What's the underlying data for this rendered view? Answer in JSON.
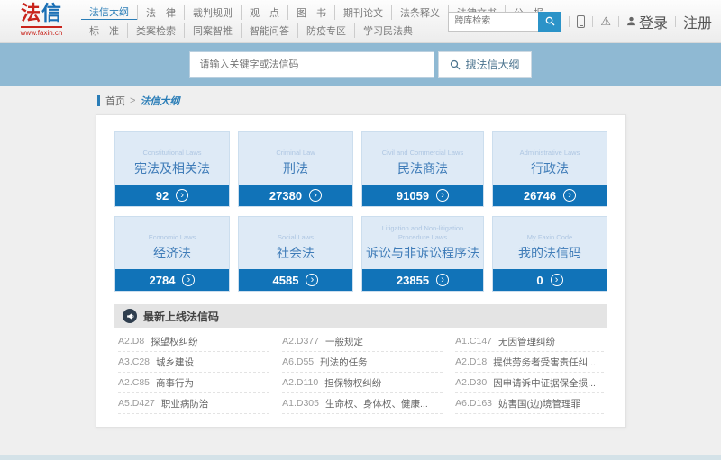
{
  "header": {
    "logo": {
      "text_red": "法",
      "text_blue": "信",
      "site_url": "www.faxin.cn"
    },
    "nav_row1": [
      {
        "label": "法信大纲"
      },
      {
        "label": "法　律"
      },
      {
        "label": "裁判规则"
      },
      {
        "label": "观　点"
      },
      {
        "label": "图　书"
      },
      {
        "label": "期刊论文"
      },
      {
        "label": "法条释义"
      },
      {
        "label": "法律文书"
      },
      {
        "label": "公　报"
      }
    ],
    "nav_row2": [
      {
        "label": "标　准"
      },
      {
        "label": "类案检索"
      },
      {
        "label": "同案智推"
      },
      {
        "label": "智能问答"
      },
      {
        "label": "防疫专区"
      },
      {
        "label": "学习民法典"
      }
    ],
    "mini_search": {
      "placeholder": "跨库检索"
    },
    "auth": {
      "login": "登录",
      "register": "注册"
    }
  },
  "search_bar": {
    "placeholder": "请输入关键字或法信码",
    "button": "搜法信大纲"
  },
  "breadcrumb": {
    "home": "首页",
    "separator": ">",
    "current": "法信大纲"
  },
  "cards": [
    {
      "en": "Constitutional Laws",
      "zh": "宪法及相关法",
      "count": "92"
    },
    {
      "en": "Criminal Law",
      "zh": "刑法",
      "count": "27380"
    },
    {
      "en": "Civil and Commercial Laws",
      "zh": "民法商法",
      "count": "91059"
    },
    {
      "en": "Administrative Laws",
      "zh": "行政法",
      "count": "26746"
    },
    {
      "en": "Economic Laws",
      "zh": "经济法",
      "count": "2784"
    },
    {
      "en": "Social Laws",
      "zh": "社会法",
      "count": "4585"
    },
    {
      "en": "Litigation and Non-litigation Procedure Laws",
      "zh": "诉讼与非诉讼程序法",
      "count": "23855"
    },
    {
      "en": "My Faxin Code",
      "zh": "我的法信码",
      "count": "0"
    }
  ],
  "latest_section": {
    "title": "最新上线法信码",
    "items": [
      {
        "code": "A2.D8",
        "title": "探望权纠纷"
      },
      {
        "code": "A2.D377",
        "title": "一般规定"
      },
      {
        "code": "A1.C147",
        "title": "无因管理纠纷"
      },
      {
        "code": "A3.C28",
        "title": "城乡建设"
      },
      {
        "code": "A6.D55",
        "title": "刑法的任务"
      },
      {
        "code": "A2.D18",
        "title": "提供劳务者受害责任纠..."
      },
      {
        "code": "A2.C85",
        "title": "商事行为"
      },
      {
        "code": "A2.D110",
        "title": "担保物权纠纷"
      },
      {
        "code": "A2.D30",
        "title": "因申请诉中证据保全损..."
      },
      {
        "code": "A5.D427",
        "title": "职业病防治"
      },
      {
        "code": "A1.D305",
        "title": "生命权、身体权、健康..."
      },
      {
        "code": "A6.D163",
        "title": "妨害国(边)境管理罪"
      }
    ]
  },
  "icons": {
    "arrow_circle": "›",
    "warning": "⚠"
  },
  "colors": {
    "primary_blue": "#1173b8",
    "band_blue": "#8fb9d3",
    "accent_red": "#c9241c"
  }
}
